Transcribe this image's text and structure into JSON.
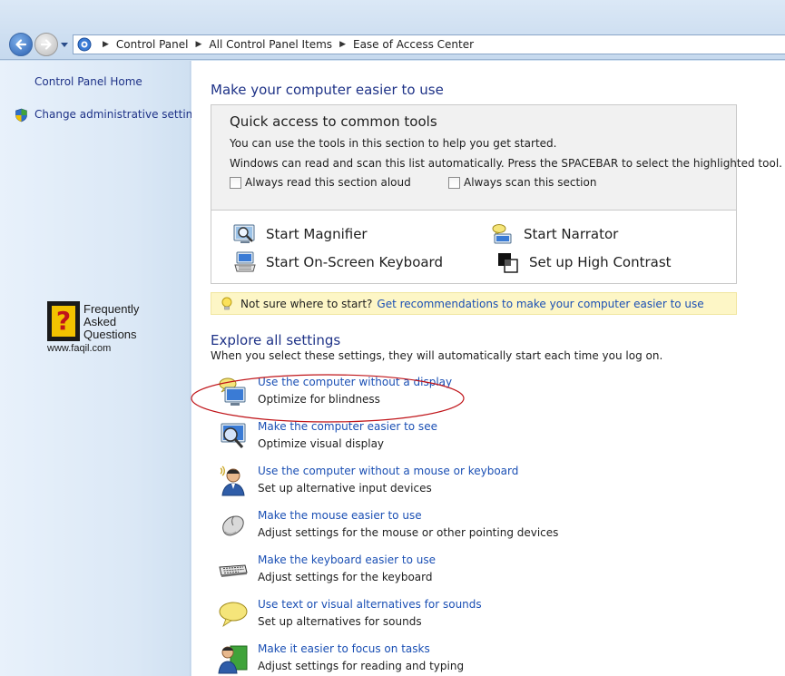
{
  "breadcrumbs": [
    "Control Panel",
    "All Control Panel Items",
    "Ease of Access Center"
  ],
  "icons": {
    "back": "back-arrow-icon",
    "forward": "forward-arrow-icon",
    "address": "control-panel-icon",
    "shield": "uac-shield-icon",
    "bulb": "lightbulb-icon"
  },
  "left_pane": {
    "home_link": "Control Panel Home",
    "admin_link": "Change administrative settings",
    "faq_logo": {
      "q_glyph": "?",
      "line1": "Frequently",
      "line2": "Asked",
      "line3": "Questions",
      "url": "www.faqil.com"
    }
  },
  "main": {
    "title": "Make your computer easier to use",
    "quick_access": {
      "title": "Quick access to common tools",
      "desc1": "You can use the tools in this section to help you get started.",
      "desc2": "Windows can read and scan this list automatically.  Press the SPACEBAR to select the highlighted tool.",
      "checkbox_read": "Always read this section aloud",
      "checkbox_scan": "Always scan this section",
      "checkbox_read_checked": false,
      "checkbox_scan_checked": false,
      "tools": {
        "magnifier": "Start Magnifier",
        "narrator": "Start Narrator",
        "keyboard": "Start On-Screen Keyboard",
        "contrast": "Set up High Contrast"
      }
    },
    "hint": {
      "text": "Not sure where to start?",
      "link": "Get recommendations to make your computer easier to use"
    },
    "explore": {
      "title": "Explore all settings",
      "desc": "When you select these settings, they will automatically start each time you log on.",
      "items": [
        {
          "link": "Use the computer without a display",
          "desc": "Optimize for blindness",
          "icon": "monitor-speaker-icon"
        },
        {
          "link": "Make the computer easier to see",
          "desc": "Optimize visual display",
          "icon": "monitor-magnifier-icon"
        },
        {
          "link": "Use the computer without a mouse or keyboard",
          "desc": "Set up alternative input devices",
          "icon": "speaking-person-icon"
        },
        {
          "link": "Make the mouse easier to use",
          "desc": "Adjust settings for the mouse or other pointing devices",
          "icon": "mouse-icon"
        },
        {
          "link": "Make the keyboard easier to use",
          "desc": "Adjust settings for the keyboard",
          "icon": "keyboard-icon"
        },
        {
          "link": "Use text or visual alternatives for sounds",
          "desc": "Set up alternatives for sounds",
          "icon": "speech-bubble-icon"
        },
        {
          "link": "Make it easier to focus on tasks",
          "desc": "Adjust settings for reading and typing",
          "icon": "focus-person-icon"
        }
      ]
    }
  },
  "colors": {
    "link": "#1a4fb4",
    "heading": "#1e3287",
    "highlight_ellipse": "#c0151a",
    "hint_background": "#fdf6c6"
  }
}
